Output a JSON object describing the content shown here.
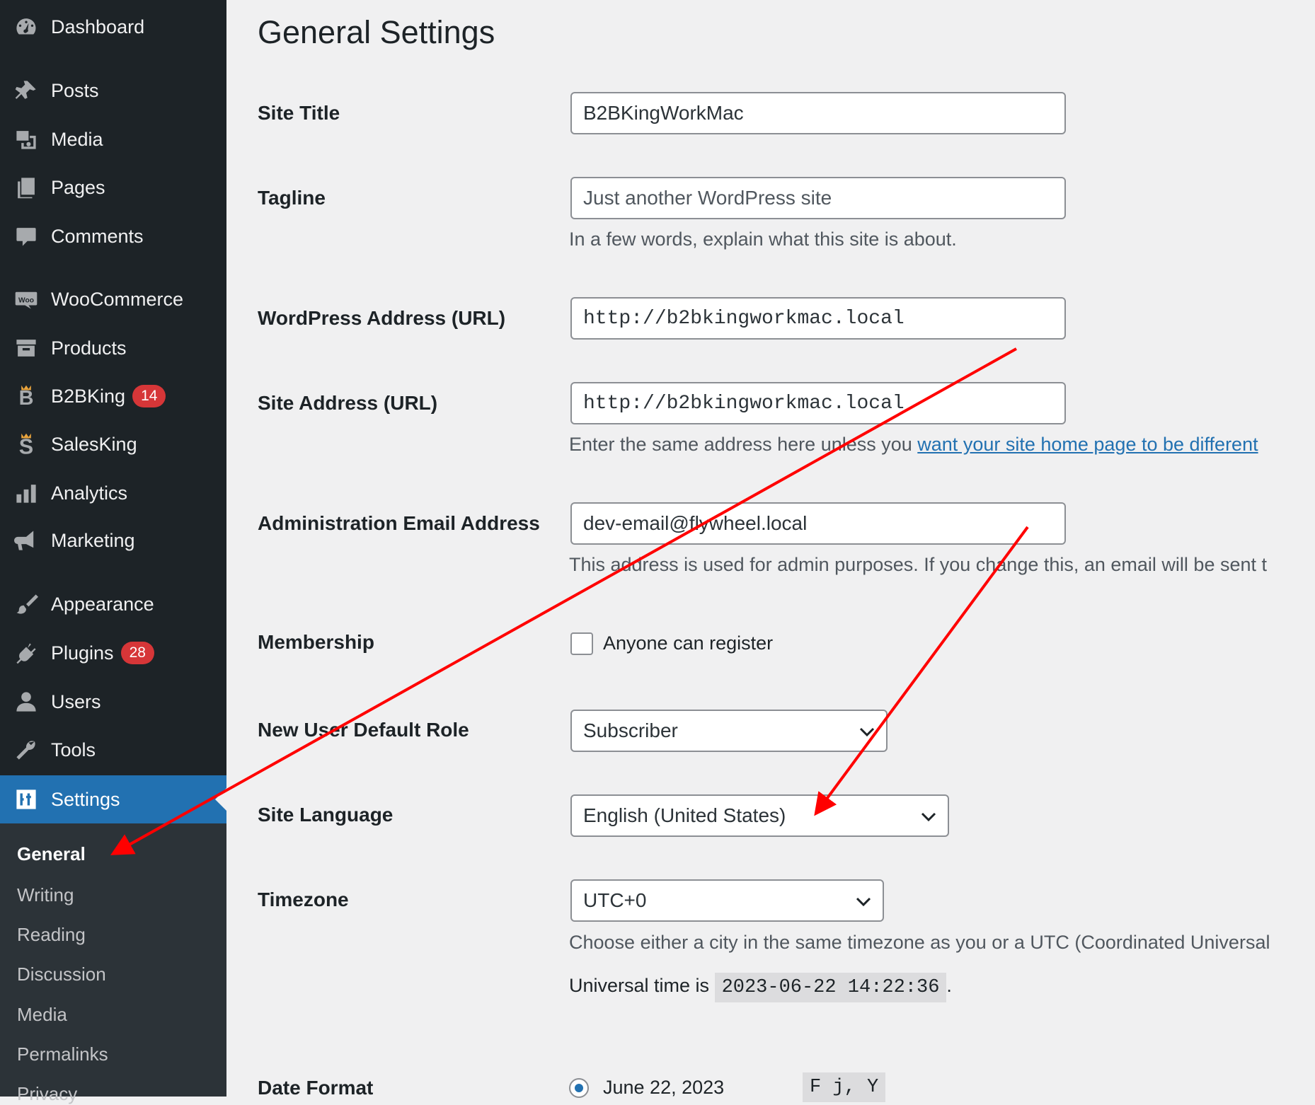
{
  "sidebar": {
    "items": [
      {
        "label": "Dashboard",
        "icon": "dashboard-icon"
      },
      {
        "label": "Posts",
        "icon": "pin-icon"
      },
      {
        "label": "Media",
        "icon": "media-icon"
      },
      {
        "label": "Pages",
        "icon": "pages-icon"
      },
      {
        "label": "Comments",
        "icon": "comment-icon"
      },
      {
        "label": "WooCommerce",
        "icon": "woo-icon"
      },
      {
        "label": "Products",
        "icon": "archive-icon"
      },
      {
        "label": "B2BKing",
        "icon": "b2bking-icon",
        "badge": "14"
      },
      {
        "label": "SalesKing",
        "icon": "salesking-icon"
      },
      {
        "label": "Analytics",
        "icon": "bar-chart-icon"
      },
      {
        "label": "Marketing",
        "icon": "megaphone-icon"
      },
      {
        "label": "Appearance",
        "icon": "brush-icon"
      },
      {
        "label": "Plugins",
        "icon": "plug-icon",
        "badge": "28"
      },
      {
        "label": "Users",
        "icon": "user-icon"
      },
      {
        "label": "Tools",
        "icon": "wrench-icon"
      },
      {
        "label": "Settings",
        "icon": "settings-sliders-icon"
      }
    ],
    "submenu": [
      "General",
      "Writing",
      "Reading",
      "Discussion",
      "Media",
      "Permalinks",
      "Privacy"
    ]
  },
  "page": {
    "title": "General Settings",
    "site_title": {
      "label": "Site Title",
      "value": "B2BKingWorkMac"
    },
    "tagline": {
      "label": "Tagline",
      "placeholder": "Just another WordPress site",
      "description": "In a few words, explain what this site is about."
    },
    "wp_address": {
      "label": "WordPress Address (URL)",
      "value": "http://b2bkingworkmac.local"
    },
    "site_address": {
      "label": "Site Address (URL)",
      "value": "http://b2bkingworkmac.local",
      "description": "Enter the same address here unless you ",
      "link": "want your site home page to be different"
    },
    "admin_email": {
      "label": "Administration Email Address",
      "value": "dev-email@flywheel.local",
      "description": "This address is used for admin purposes. If you change this, an email will be sent t"
    },
    "membership": {
      "label": "Membership",
      "checkbox_label": "Anyone can register",
      "checked": false
    },
    "default_role": {
      "label": "New User Default Role",
      "value": "Subscriber"
    },
    "site_language": {
      "label": "Site Language",
      "value": "English (United States)"
    },
    "timezone": {
      "label": "Timezone",
      "value": "UTC+0",
      "description": "Choose either a city in the same timezone as you or a UTC (Coordinated Universal",
      "universal_prefix": "Universal time is",
      "universal_time": "2023-06-22 14:22:36",
      "universal_suffix": "."
    },
    "date_format": {
      "label": "Date Format",
      "option_label": "June 22, 2023",
      "option_code": "F j, Y"
    }
  },
  "colors": {
    "sidebar_bg": "#1d2327",
    "accent": "#2271b1",
    "badge": "#d63638",
    "annotation_arrow": "#ff0000"
  }
}
